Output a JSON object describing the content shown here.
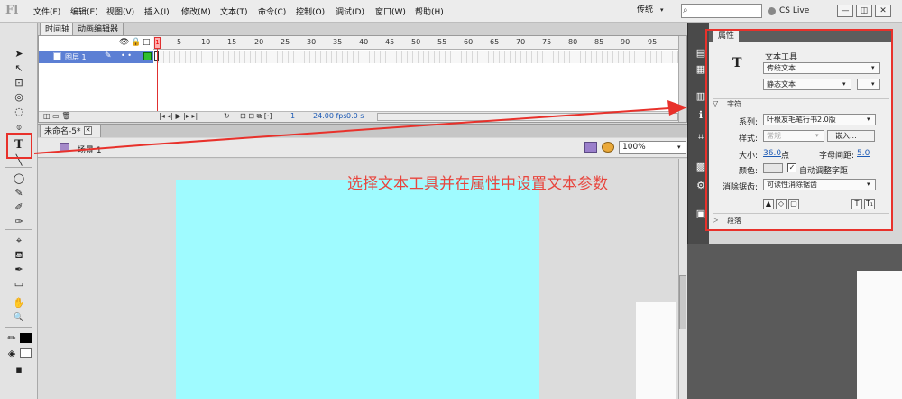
{
  "app": {
    "logo": "Fl"
  },
  "menu": [
    "文件(F)",
    "编辑(E)",
    "视图(V)",
    "插入(I)",
    "修改(M)",
    "文本(T)",
    "命令(C)",
    "控制(O)",
    "调试(D)",
    "窗口(W)",
    "帮助(H)"
  ],
  "topbar": {
    "workspace": "传统",
    "workspace_arrow": "▾",
    "search_icon": "⌕",
    "cs_live": "CS Live",
    "window_buttons": [
      "—",
      "◫",
      "✕"
    ]
  },
  "toolbar": {
    "tools": [
      "➤",
      "↖",
      "⊡",
      "◎",
      "◌",
      "⌽",
      "T",
      "╲",
      "◯",
      "✎",
      "✐",
      "✑",
      "⌖",
      "⛾",
      "✒",
      "▭",
      "✋",
      "🔍",
      "✏",
      "◈",
      "▪"
    ],
    "selected": "T"
  },
  "timeline": {
    "tabs": [
      "时间轴",
      "动画编辑器"
    ],
    "header_icons": [
      "👁",
      "🔒",
      "□"
    ],
    "ruler": [
      "1",
      "5",
      "10",
      "15",
      "20",
      "25",
      "30",
      "35",
      "40",
      "45",
      "50",
      "55",
      "60",
      "65",
      "70",
      "75",
      "80",
      "85",
      "90",
      "95"
    ],
    "playhead": "1",
    "layer": {
      "name": "图层 1",
      "pencil": "✎",
      "dots": "•  •"
    },
    "footer": {
      "controls": "|◂ ◂| ▶ |▸ ▸|",
      "loop": "↻",
      "onion": "⊡ ⊡ ⧉ [·]",
      "frame": "1",
      "fps": "24.00 fps",
      "time": "0.0 s",
      "layer_ctrls": "◫ ▭ 🗑"
    }
  },
  "document": {
    "tab": "未命名-5*",
    "close": "✕",
    "scene": "场景 1",
    "zoom": "100%",
    "zoom_arrow": "▾"
  },
  "annotation": "选择文本工具并在属性中设置文本参数",
  "properties": {
    "tab": "属性",
    "tool_icon": "T",
    "tool_name": "文本工具",
    "text_type": "传统文本",
    "text_mode": "静态文本",
    "sections": {
      "character": "字符",
      "paragraph": "段落"
    },
    "character": {
      "family_label": "系列:",
      "family": "叶根友毛笔行书2.0版",
      "style_label": "样式:",
      "style": "常规",
      "embed": "嵌入...",
      "size_label": "大小:",
      "size": "36.0",
      "size_unit": "点",
      "spacing_label": "字母间距:",
      "spacing": "5.0",
      "color_label": "颜色:",
      "auto_kern_check": "✓",
      "auto_kern": "自动调整字距",
      "aa_label": "消除锯齿:",
      "aa": "可读性消除锯齿"
    },
    "bottom_buttons": [
      "▲",
      "◇",
      "▢",
      "T",
      "T₁"
    ],
    "arrows": {
      "collapse": "▽",
      "expand": "▷",
      "dropdown": "▾"
    }
  },
  "side_icons": [
    "▤",
    "▦",
    "▥",
    "ℹ",
    "⌗",
    "▩",
    "⚙",
    "▣"
  ],
  "colors": {
    "stage": "#9ffbff",
    "highlight": "#e8312b",
    "layer": "#5c7fd4",
    "annotation": "#e8463e"
  }
}
